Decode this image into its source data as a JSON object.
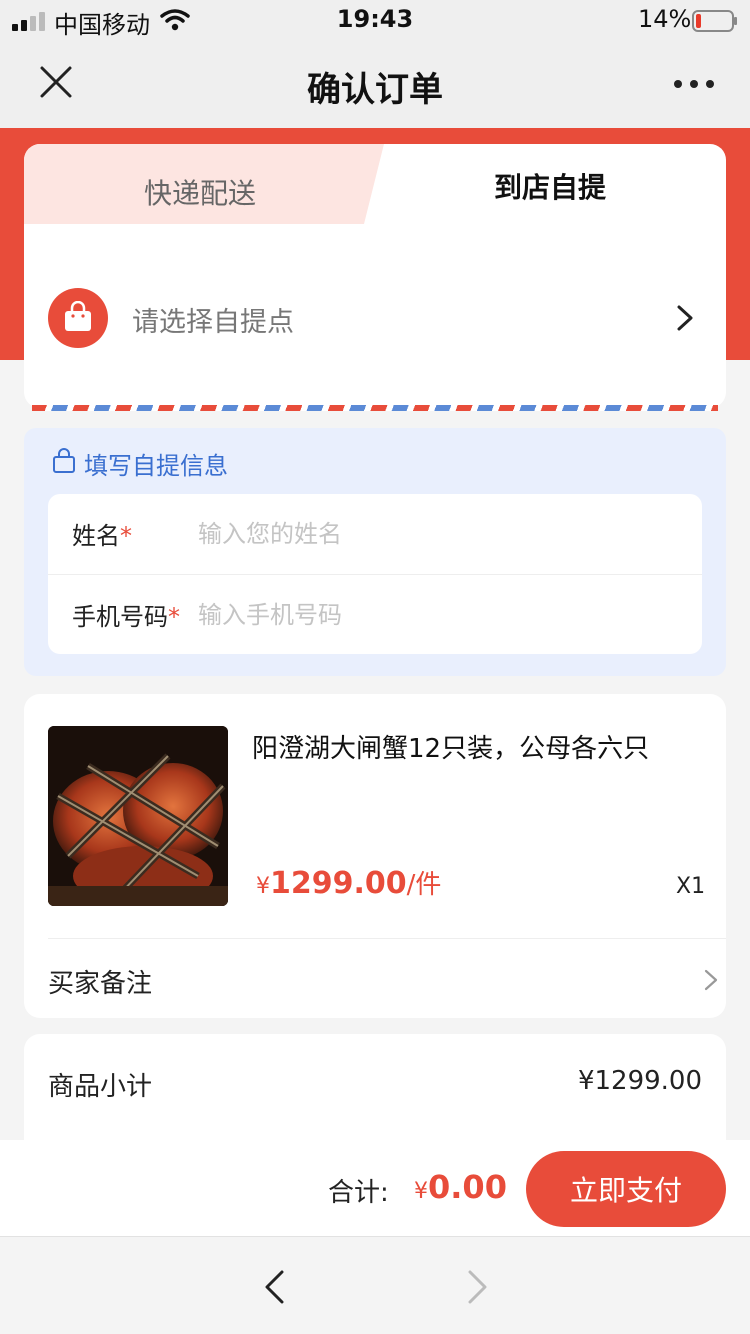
{
  "status_bar": {
    "carrier": "中国移动",
    "time": "19:43",
    "battery_pct": "14%",
    "battery_level": 0.14
  },
  "nav": {
    "title": "确认订单"
  },
  "delivery": {
    "tabs": [
      {
        "label": "快递配送",
        "active": false
      },
      {
        "label": "到店自提",
        "active": true
      }
    ],
    "pickup_point_label": "请选择自提点"
  },
  "pickup_info": {
    "heading": "填写自提信息",
    "fields": [
      {
        "label": "姓名",
        "required_mark": "*",
        "placeholder": "输入您的姓名",
        "value": ""
      },
      {
        "label": "手机号码",
        "required_mark": "*",
        "placeholder": "输入手机号码",
        "value": ""
      }
    ]
  },
  "product": {
    "name": "阳澄湖大闸蟹12只装，公母各六只",
    "price_symbol": "¥",
    "price": "1299.00",
    "price_unit": "/件",
    "quantity": "X1",
    "note_label": "买家备注"
  },
  "summary": {
    "subtotal_label": "商品小计",
    "subtotal_value": "¥1299.00"
  },
  "paybar": {
    "total_label": "合计:",
    "total_symbol": "¥",
    "total_value": "0.00",
    "pay_button": "立即支付"
  },
  "colors": {
    "accent": "#e84c3a",
    "info_blue": "#3a6fd0",
    "info_bg": "#e9effd"
  }
}
